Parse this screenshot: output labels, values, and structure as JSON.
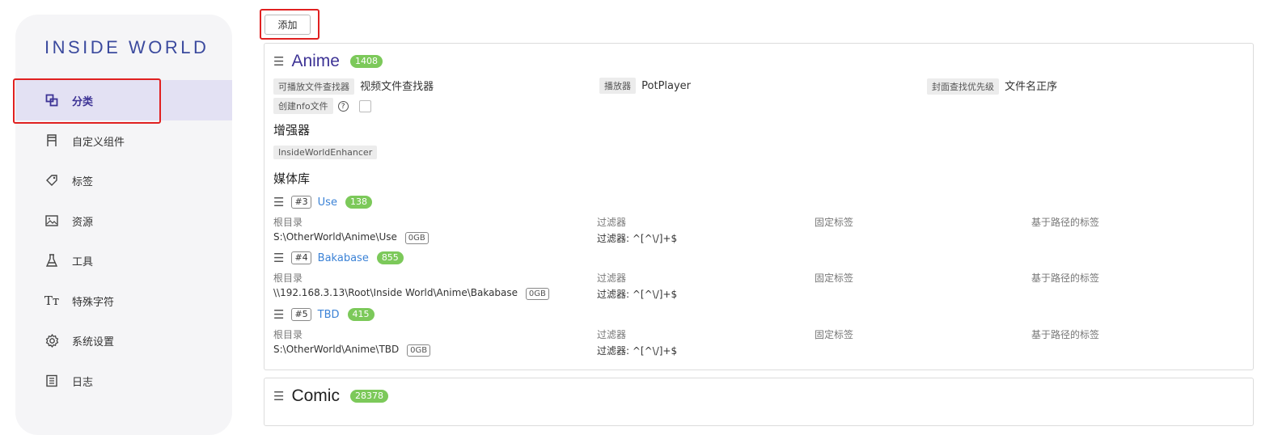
{
  "app": {
    "logo": "INSIDE WORLD"
  },
  "sidebar": {
    "items": [
      {
        "label": "分类",
        "icon": "category-icon",
        "active": true
      },
      {
        "label": "自定义组件",
        "icon": "component-icon"
      },
      {
        "label": "标签",
        "icon": "tag-icon"
      },
      {
        "label": "资源",
        "icon": "image-icon"
      },
      {
        "label": "工具",
        "icon": "flask-icon"
      },
      {
        "label": "特殊字符",
        "icon": "text-icon"
      },
      {
        "label": "系统设置",
        "icon": "gear-icon"
      },
      {
        "label": "日志",
        "icon": "log-icon"
      }
    ]
  },
  "toolbar": {
    "add_label": "添加"
  },
  "categories": [
    {
      "name": "Anime",
      "count": "1408",
      "props": {
        "player_finder_label": "可播放文件查找器",
        "player_finder_value": "视频文件查找器",
        "player_label": "播放器",
        "player_value": "PotPlayer",
        "cover_label": "封面查找优先级",
        "cover_value": "文件名正序",
        "nfo_label": "创建nfo文件"
      },
      "enhancer_heading": "增强器",
      "enhancer": "InsideWorldEnhancer",
      "media_heading": "媒体库",
      "libraries": [
        {
          "id": "#3",
          "name": "Use",
          "count": "138",
          "root_label": "根目录",
          "root": "S:\\OtherWorld\\Anime\\Use",
          "size": "0GB",
          "filter_label": "过滤器",
          "filter": "过滤器: ^[^\\/]+$",
          "fixed_label": "固定标签",
          "path_label": "基于路径的标签"
        },
        {
          "id": "#4",
          "name": "Bakabase",
          "count": "855",
          "root_label": "根目录",
          "root": "\\\\192.168.3.13\\Root\\Inside World\\Anime\\Bakabase",
          "size": "0GB",
          "filter_label": "过滤器",
          "filter": "过滤器: ^[^\\/]+$",
          "fixed_label": "固定标签",
          "path_label": "基于路径的标签"
        },
        {
          "id": "#5",
          "name": "TBD",
          "count": "415",
          "root_label": "根目录",
          "root": "S:\\OtherWorld\\Anime\\TBD",
          "size": "0GB",
          "filter_label": "过滤器",
          "filter": "过滤器: ^[^\\/]+$",
          "fixed_label": "固定标签",
          "path_label": "基于路径的标签"
        }
      ]
    },
    {
      "name": "Comic",
      "count": "28378"
    }
  ],
  "colors": {
    "accent": "#3d3395",
    "badge": "#7cc95a",
    "link": "#3b82d6",
    "highlight": "#e02020"
  }
}
